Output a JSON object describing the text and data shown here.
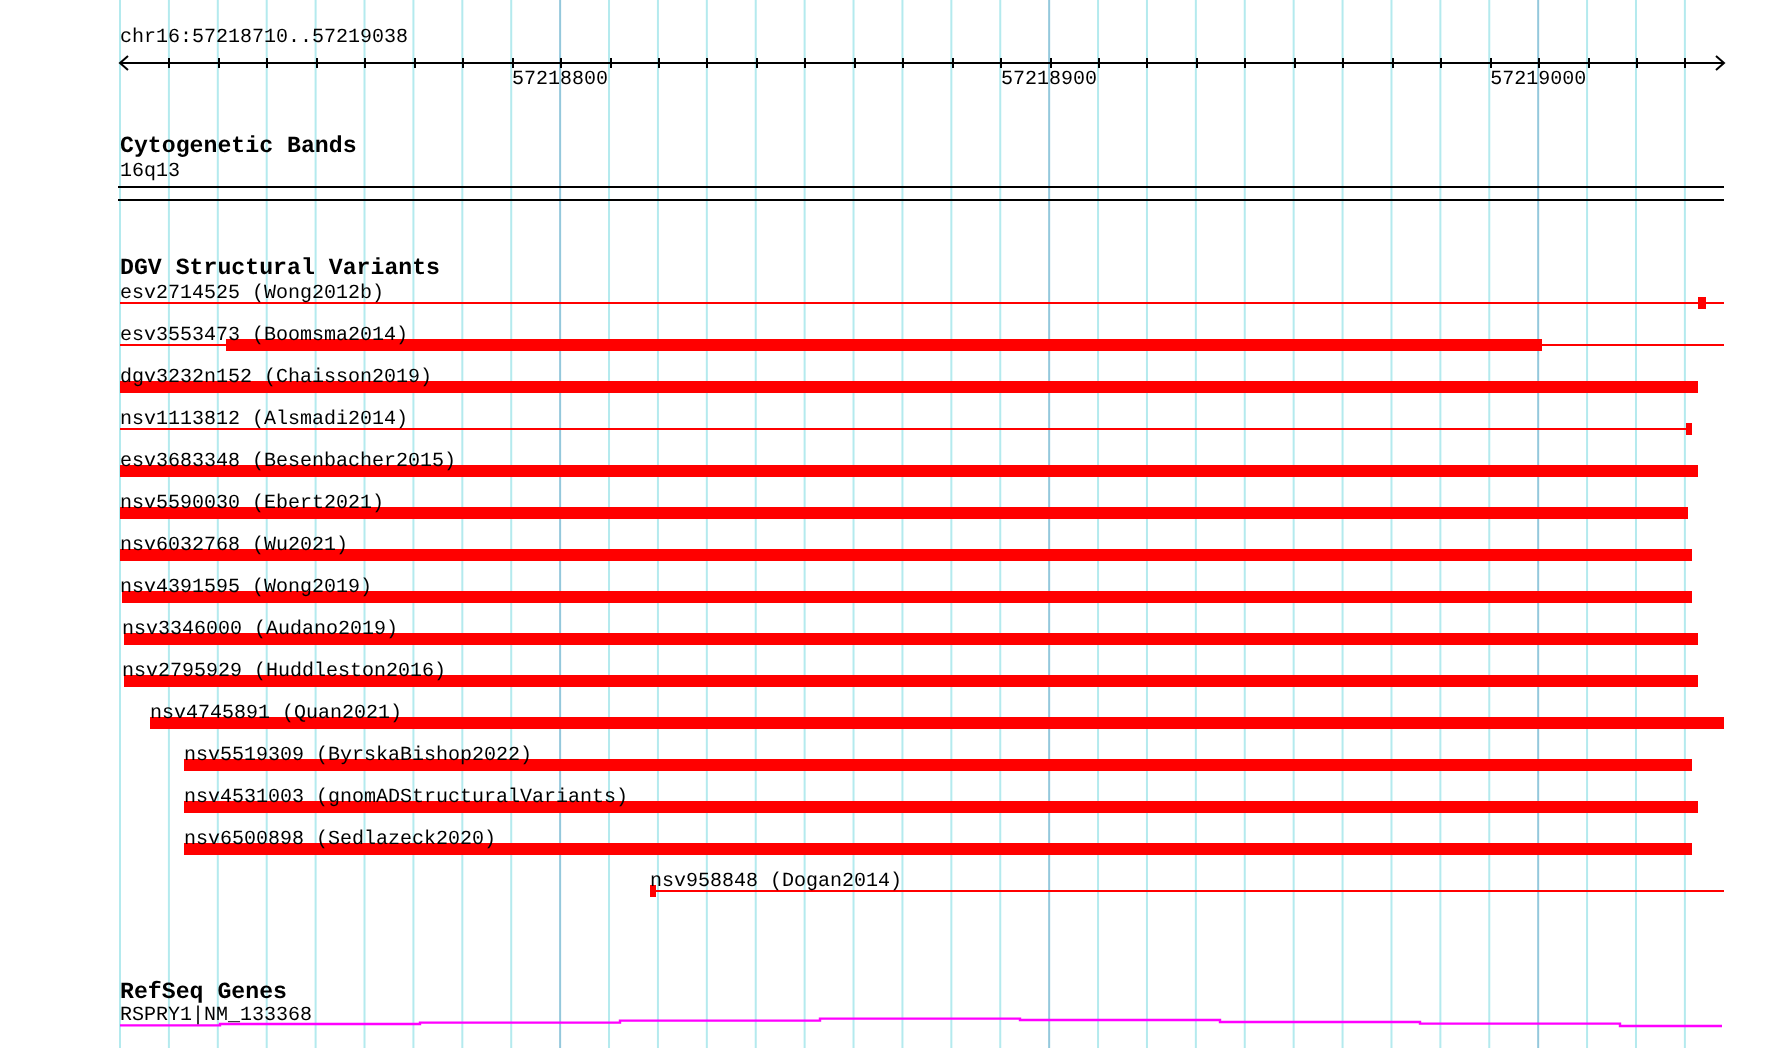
{
  "ruler": {
    "region": "chr16:57218710..57219038",
    "ticks": [
      "57218800",
      "57218900",
      "57219000"
    ]
  },
  "tracks": [
    {
      "kind": "cytoband",
      "title": "Cytogenetic Bands",
      "features": [
        {
          "label": "16q13"
        }
      ]
    },
    {
      "kind": "variants",
      "title": "DGV Structural Variants",
      "features": [
        {
          "label": "esv2714525 (Wong2012b)"
        },
        {
          "label": "esv3553473 (Boomsma2014)"
        },
        {
          "label": "dgv3232n152 (Chaisson2019)"
        },
        {
          "label": "nsv1113812 (Alsmadi2014)"
        },
        {
          "label": "esv3683348 (Besenbacher2015)"
        },
        {
          "label": "nsv5590030 (Ebert2021)"
        },
        {
          "label": "nsv6032768 (Wu2021)"
        },
        {
          "label": "nsv4391595 (Wong2019)"
        },
        {
          "label": "nsv3346000 (Audano2019)"
        },
        {
          "label": "nsv2795929 (Huddleston2016)"
        },
        {
          "label": "nsv4745891 (Quan2021)"
        },
        {
          "label": "nsv5519309 (ByrskaBishop2022)"
        },
        {
          "label": "nsv4531003 (gnomADStructuralVariants)"
        },
        {
          "label": "nsv6500898 (Sedlazeck2020)"
        },
        {
          "label": "nsv958848 (Dogan2014)"
        }
      ]
    },
    {
      "kind": "gene",
      "title": "RefSeq Genes",
      "features": [
        {
          "label": "RSPRY1|NM_133368"
        }
      ]
    }
  ]
}
